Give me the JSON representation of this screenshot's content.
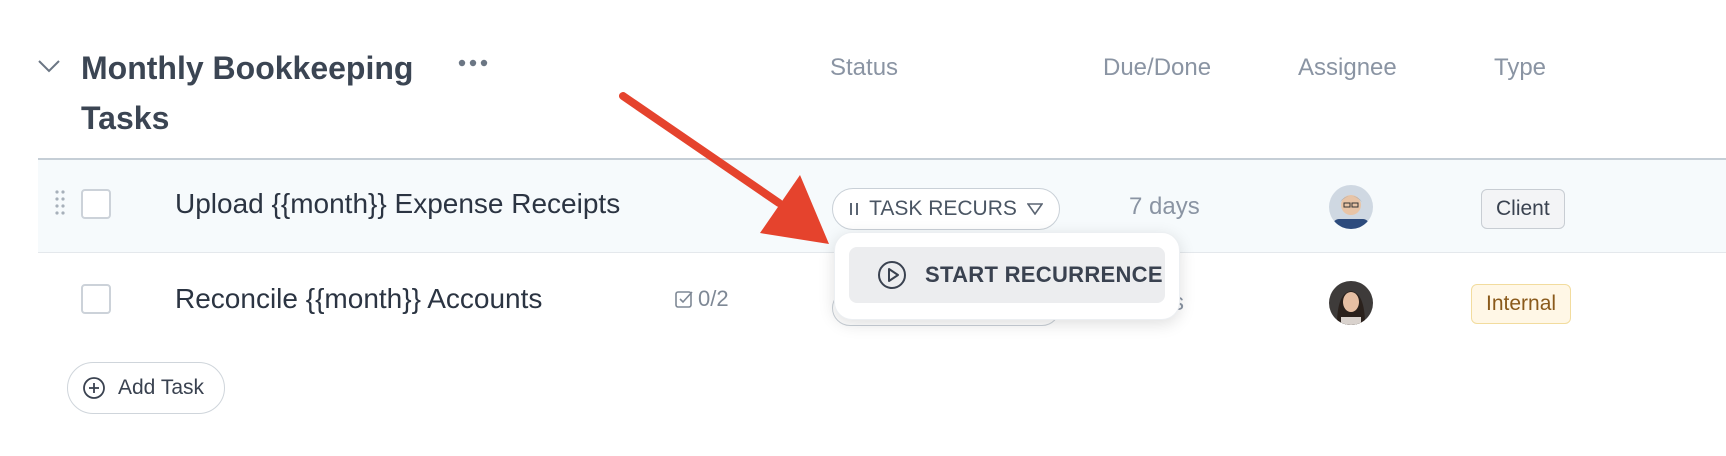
{
  "group": {
    "title": "Monthly Bookkeeping Tasks"
  },
  "columns": {
    "status": "Status",
    "due": "Due/Done",
    "assignee": "Assignee",
    "type": "Type"
  },
  "tasks": [
    {
      "name": "Upload {{month}} Expense Receipts",
      "status": "TASK RECURS",
      "due": "7 days",
      "type": "Client"
    },
    {
      "name": "Reconcile {{month}} Accounts",
      "subtasks": "0/2",
      "due_visible": "ys",
      "type": "Internal"
    }
  ],
  "dropdown": {
    "start_recurrence": "START RECURRENCE"
  },
  "add_task_label": "Add Task",
  "colors": {
    "annotation_arrow": "#e5432d",
    "internal_tag_bg": "#fff7e6",
    "internal_tag_text": "#8a5a1b"
  }
}
